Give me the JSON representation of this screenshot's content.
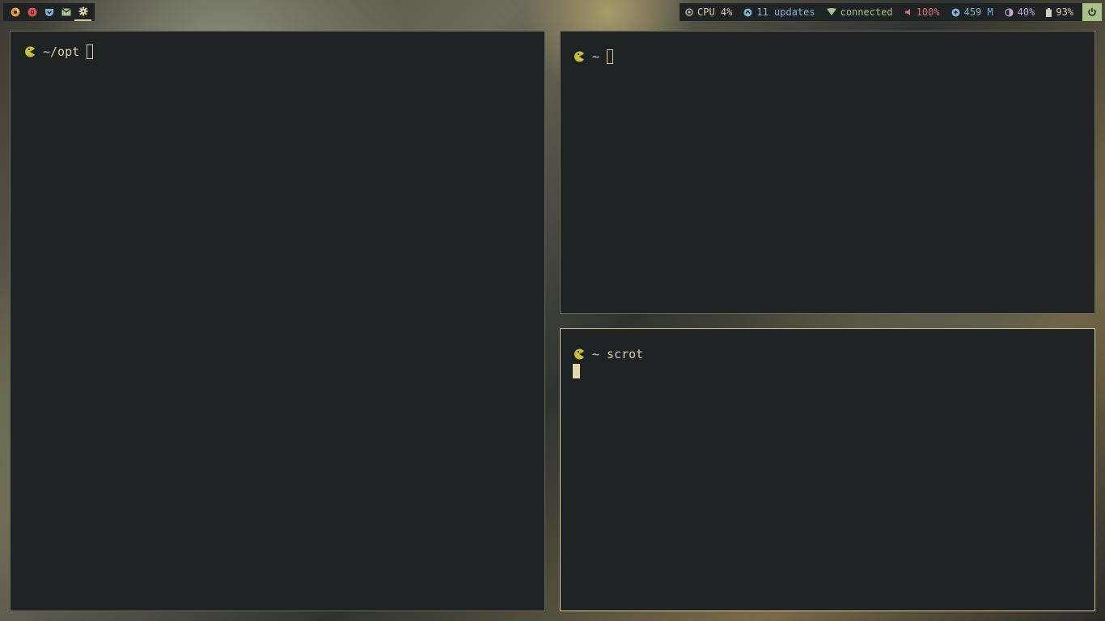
{
  "launcher": {
    "icons": [
      "firefox-icon",
      "chrome-icon",
      "pocket-icon",
      "mail-icon",
      "settings-icon"
    ],
    "active": "settings-icon"
  },
  "statusbar": {
    "cpu": "CPU 4%",
    "updates": "11 updates",
    "network": "connected",
    "volume": "100%",
    "memory": "459 M",
    "brightness": "40%",
    "battery": "93%",
    "colors": {
      "updates": "#7fb4d8",
      "network": "#a8c28a",
      "volume": "#e06c75",
      "brightness": "#c9a6d8",
      "text": "#d8cfb0",
      "power_bg": "#a8c28a"
    }
  },
  "terminals": {
    "left": {
      "dir": "~/opt",
      "command": ""
    },
    "top_right": {
      "dir": "~",
      "command": ""
    },
    "bottom_right": {
      "dir": "~",
      "command": "scrot"
    }
  },
  "colors": {
    "terminal_bg": "#1e2222",
    "prompt_icon": "#c8c23a",
    "border": "#6b6656",
    "border_focused": "#d4c79c"
  }
}
